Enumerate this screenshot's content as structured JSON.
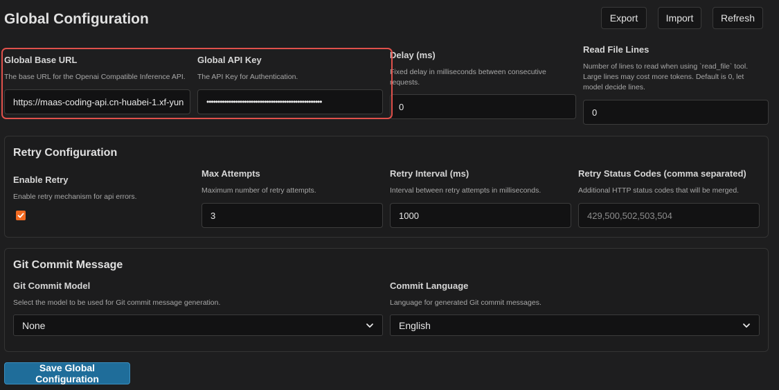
{
  "page": {
    "title": "Global Configuration"
  },
  "toolbar": {
    "export_label": "Export",
    "import_label": "Import",
    "refresh_label": "Refresh"
  },
  "base_url": {
    "label": "Global Base URL",
    "description": "The base URL for the Openai Compatible Inference API.",
    "value": "https://maas-coding-api.cn-huabei-1.xf-yun"
  },
  "api_key": {
    "label": "Global API Key",
    "description": "The API Key for Authentication.",
    "value": "••••••••••••••••••••••••••••••••••••••••••••••••••••"
  },
  "delay": {
    "label": "Delay (ms)",
    "description": "Fixed delay in milliseconds between consecutive requests.",
    "value": "0"
  },
  "read_file_lines": {
    "label": "Read File Lines",
    "description": "Number of lines to read when using `read_file` tool. Large lines may cost more tokens. Default is 0, let model decide lines.",
    "value": "0"
  },
  "retry": {
    "title": "Retry Configuration",
    "enable": {
      "label": "Enable Retry",
      "description": "Enable retry mechanism for api errors.",
      "checked": true
    },
    "max_attempts": {
      "label": "Max Attempts",
      "description": "Maximum number of retry attempts.",
      "value": "3"
    },
    "interval": {
      "label": "Retry Interval (ms)",
      "description": "Interval between retry attempts in milliseconds.",
      "value": "1000"
    },
    "status_codes": {
      "label": "Retry Status Codes (comma separated)",
      "description": "Additional HTTP status codes that will be merged.",
      "placeholder": "429,500,502,503,504"
    }
  },
  "git": {
    "title": "Git Commit Message",
    "model": {
      "label": "Git Commit Model",
      "description": "Select the model to be used for Git commit message generation.",
      "selected": "None"
    },
    "language": {
      "label": "Commit Language",
      "description": "Language for generated Git commit messages.",
      "selected": "English"
    }
  },
  "save": {
    "label": "Save Global Configuration"
  },
  "colors": {
    "accent": "#1f6d9a",
    "highlight": "#e0514b",
    "checkbox": "#f26a21",
    "background": "#1e1e1f"
  }
}
